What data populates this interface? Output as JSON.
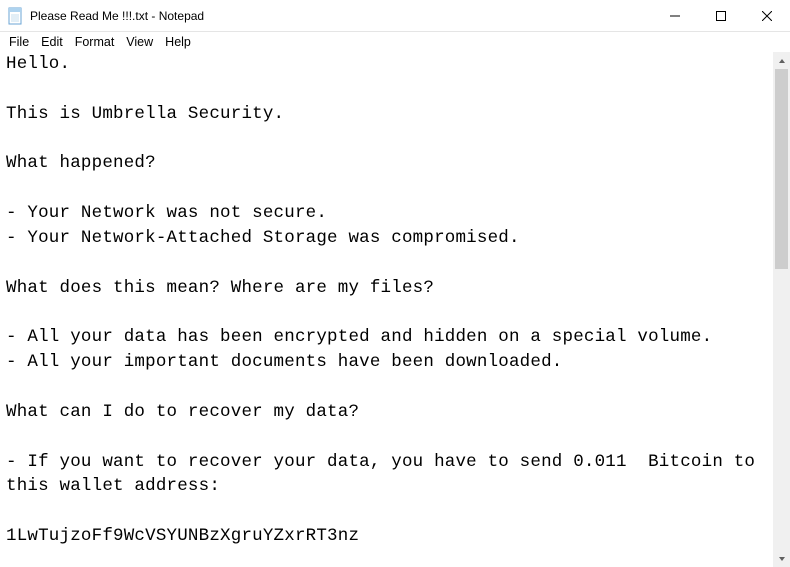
{
  "window": {
    "title": "Please Read Me !!!.txt - Notepad"
  },
  "menu": {
    "file": "File",
    "edit": "Edit",
    "format": "Format",
    "view": "View",
    "help": "Help"
  },
  "content": {
    "text": "Hello.\n\nThis is Umbrella Security.\n\nWhat happened?\n\n- Your Network was not secure.\n- Your Network-Attached Storage was compromised.\n\nWhat does this mean? Where are my files?\n\n- All your data has been encrypted and hidden on a special volume.\n- All your important documents have been downloaded.\n\nWhat can I do to recover my data?\n\n- If you want to recover your data, you have to send 0.011  Bitcoin to this wallet address:\n\n1LwTujzoFf9WcVSYUNBzXgruYZxrRT3nz"
  }
}
